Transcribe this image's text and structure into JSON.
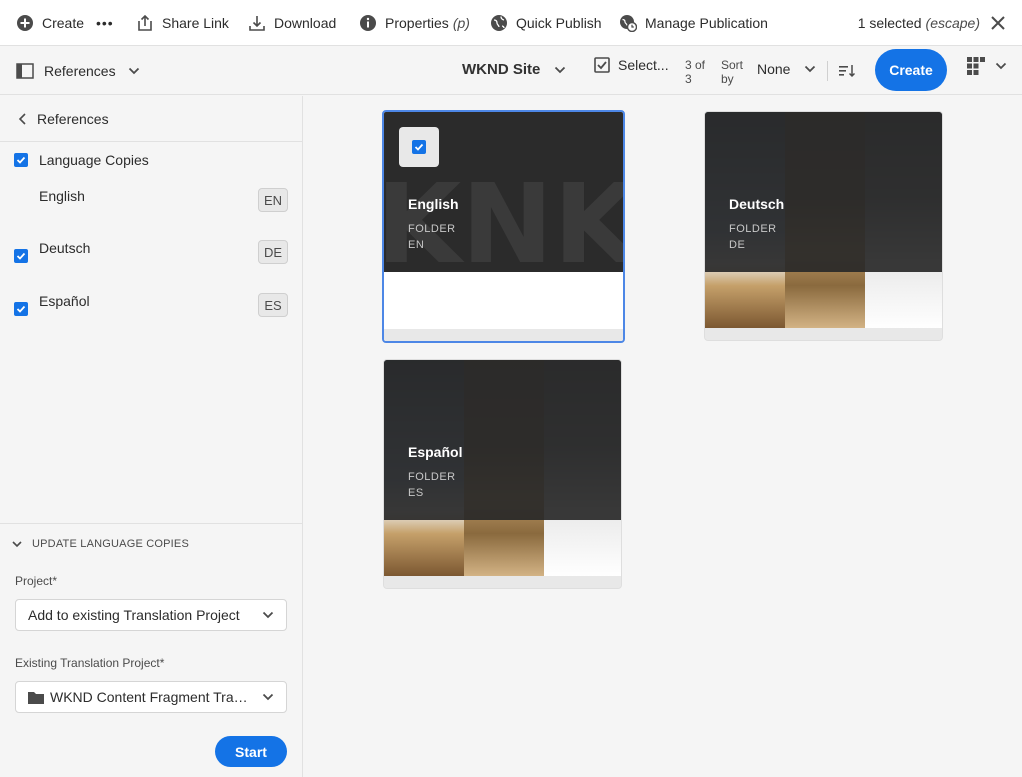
{
  "actionbar": {
    "create": "Create",
    "more": "•••",
    "share_link": "Share Link",
    "download": "Download",
    "properties": "Properties",
    "properties_hint": "(p)",
    "quick_publish": "Quick Publish",
    "manage_publication": "Manage Publication",
    "selected_count": "1 selected",
    "escape_hint": "(escape)"
  },
  "toolbar": {
    "rail_label": "References",
    "site_title": "WKND Site",
    "select_label": "Select...",
    "count_line1": "3 of",
    "count_line2": "3",
    "sort_line1": "Sort",
    "sort_line2": "by",
    "sort_value": "None",
    "create_label": "Create"
  },
  "rail": {
    "back_label": "References",
    "language_copies_label": "Language Copies",
    "languages": [
      {
        "name": "English",
        "code": "EN",
        "checked": false
      },
      {
        "name": "Deutsch",
        "code": "DE",
        "checked": true
      },
      {
        "name": "Español",
        "code": "ES",
        "checked": true
      }
    ],
    "update_heading": "UPDATE LANGUAGE COPIES",
    "project_label": "Project*",
    "project_value": "Add to existing Translation Project",
    "existing_label": "Existing Translation Project*",
    "existing_value": "WKND Content Fragment Translation Project",
    "start_label": "Start"
  },
  "cards": [
    {
      "title": "English",
      "type": "FOLDER",
      "code": "EN",
      "selected": true
    },
    {
      "title": "Deutsch",
      "type": "FOLDER",
      "code": "DE",
      "selected": false
    },
    {
      "title": "Español",
      "type": "FOLDER",
      "code": "ES",
      "selected": false
    }
  ],
  "colors": {
    "accent": "#1473e6",
    "selection_border": "#4d87e6"
  }
}
